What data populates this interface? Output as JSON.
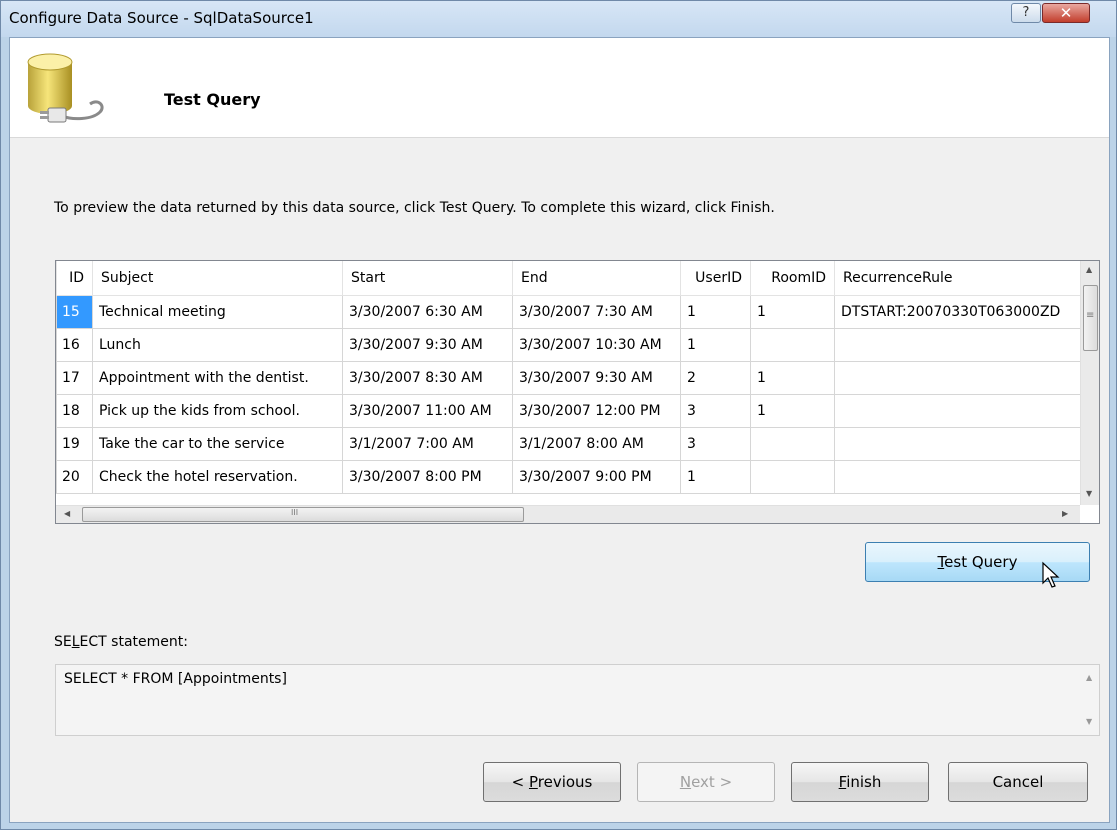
{
  "window": {
    "title": "Configure Data Source - SqlDataSource1",
    "help_glyph": "?",
    "close_glyph": "✕"
  },
  "header": {
    "title": "Test Query",
    "icon": "database-plug-icon"
  },
  "instructions": "To preview the data returned by this data source, click Test Query. To complete this wizard, click Finish.",
  "grid": {
    "columns": [
      "ID",
      "Subject",
      "Start",
      "End",
      "UserID",
      "RoomID",
      "RecurrenceRule"
    ],
    "rows": [
      {
        "id": "15",
        "subject": "Technical meeting",
        "start": "3/30/2007 6:30 AM",
        "end": "3/30/2007 7:30 AM",
        "userid": "1",
        "roomid": "1",
        "rule": "DTSTART:20070330T063000ZD"
      },
      {
        "id": "16",
        "subject": "Lunch",
        "start": "3/30/2007 9:30 AM",
        "end": "3/30/2007 10:30 AM",
        "userid": "1",
        "roomid": "",
        "rule": ""
      },
      {
        "id": "17",
        "subject": "Appointment with the dentist.",
        "start": "3/30/2007 8:30 AM",
        "end": "3/30/2007 9:30 AM",
        "userid": "2",
        "roomid": "1",
        "rule": ""
      },
      {
        "id": "18",
        "subject": "Pick up the kids from school.",
        "start": "3/30/2007 11:00 AM",
        "end": "3/30/2007 12:00 PM",
        "userid": "3",
        "roomid": "1",
        "rule": ""
      },
      {
        "id": "19",
        "subject": "Take the car to the service",
        "start": "3/1/2007 7:00 AM",
        "end": "3/1/2007 8:00 AM",
        "userid": "3",
        "roomid": "",
        "rule": ""
      },
      {
        "id": "20",
        "subject": "Check the hotel reservation.",
        "start": "3/30/2007 8:00 PM",
        "end": "3/30/2007 9:00 PM",
        "userid": "1",
        "roomid": "",
        "rule": ""
      }
    ],
    "selected_row_id": "15",
    "hscroll_glyph": "III",
    "vscroll_glyph": "≡"
  },
  "test_query_button": {
    "mnemonic": "T",
    "rest": "est Query"
  },
  "select_label": {
    "pre": "SE",
    "mnemonic": "L",
    "post": "ECT statement:"
  },
  "sql_text": "SELECT * FROM [Appointments]",
  "footer": {
    "previous": {
      "pre": "< ",
      "mnemonic": "P",
      "rest": "revious"
    },
    "next": {
      "mnemonic": "N",
      "rest": "ext >"
    },
    "finish": {
      "mnemonic": "F",
      "rest": "inish"
    },
    "cancel": "Cancel"
  },
  "colors": {
    "selection": "#3399ff",
    "hot_button": "#bee6fd",
    "title_bar": "#c3d8ee"
  }
}
